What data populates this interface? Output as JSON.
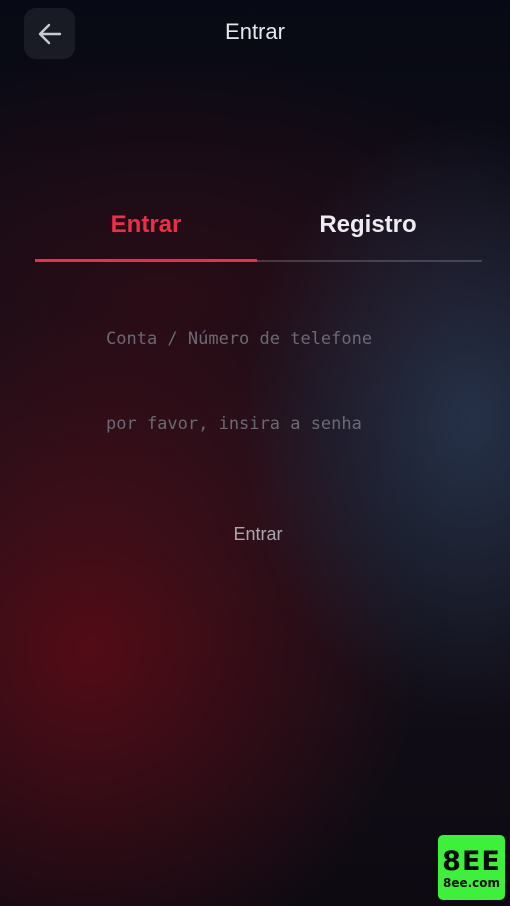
{
  "header": {
    "title": "Entrar",
    "back_icon": "arrow-left-icon"
  },
  "tabs": [
    {
      "label": "Entrar",
      "active": true
    },
    {
      "label": "Registro",
      "active": false
    }
  ],
  "form": {
    "account_placeholder": "Conta / Número de telefone",
    "password_placeholder": "por favor, insira a senha",
    "submit_label": "Entrar"
  },
  "brand": {
    "logo_text": "8EE",
    "logo_domain": "8ee.com"
  },
  "colors": {
    "accent": "#ee2e48",
    "brand_green": "#3df03a"
  }
}
